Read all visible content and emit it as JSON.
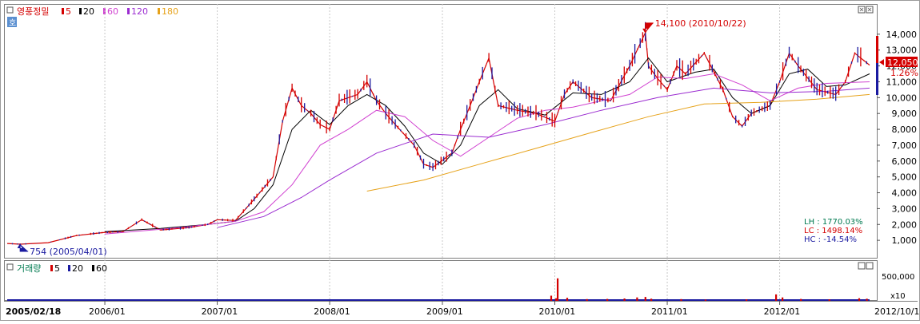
{
  "header": {
    "stock_name": "영풍정밀",
    "toggle_label": "호"
  },
  "price_panel": {
    "ma_legend": [
      {
        "label": "5",
        "color": "#d40000"
      },
      {
        "label": "20",
        "color": "#000000"
      },
      {
        "label": "60",
        "color": "#d040d0"
      },
      {
        "label": "120",
        "color": "#9a2bd0"
      },
      {
        "label": "180",
        "color": "#e6a21a"
      }
    ],
    "high_annotation": "14,100 (2010/10/22)",
    "low_annotation": "754 (2005/04/01)",
    "current_price": "12,050",
    "change_pct": "1.26%",
    "stats": [
      {
        "label": "LH",
        "value": "1770.03%",
        "color": "#007a50"
      },
      {
        "label": "LC",
        "value": "1498.14%",
        "color": "#d40000"
      },
      {
        "label": "HC",
        "value": "-14.54%",
        "color": "#1a1aa0"
      }
    ]
  },
  "volume_panel": {
    "title": "거래량",
    "ma_legend": [
      {
        "label": "5",
        "color": "#d40000"
      },
      {
        "label": "20",
        "color": "#1a1aa0"
      },
      {
        "label": "60",
        "color": "#000000"
      }
    ],
    "y_tick": "500,000",
    "multiplier": "x10"
  },
  "x_axis": {
    "start_label": "2005/02/18",
    "end_label": "2012/10/19",
    "ticks": [
      "2006/01",
      "2007/01",
      "2008/01",
      "2009/01",
      "2010/01",
      "2011/01",
      "2012/01"
    ]
  },
  "chart_data": {
    "type": "line",
    "y_ticks": [
      "1,000",
      "2,000",
      "3,000",
      "4,000",
      "5,000",
      "6,000",
      "7,000",
      "8,000",
      "9,000",
      "10,000",
      "11,000",
      "12,000",
      "13,000",
      "14,000"
    ],
    "ylim": [
      0,
      15000
    ],
    "xlim": [
      "2005-02-18",
      "2012-10-19"
    ],
    "series": [
      {
        "name": "5",
        "color": "#d40000",
        "points": [
          [
            "2005-02-18",
            800
          ],
          [
            "2005-04-01",
            754
          ],
          [
            "2005-07-01",
            850
          ],
          [
            "2005-10-01",
            1300
          ],
          [
            "2006-01-01",
            1500
          ],
          [
            "2006-03-01",
            1550
          ],
          [
            "2006-05-01",
            2300
          ],
          [
            "2006-07-01",
            1650
          ],
          [
            "2006-10-01",
            1800
          ],
          [
            "2006-12-01",
            2000
          ],
          [
            "2007-01-01",
            2300
          ],
          [
            "2007-03-01",
            2250
          ],
          [
            "2007-05-01",
            3600
          ],
          [
            "2007-07-01",
            5000
          ],
          [
            "2007-08-01",
            8500
          ],
          [
            "2007-09-01",
            10600
          ],
          [
            "2007-10-01",
            9500
          ],
          [
            "2007-11-01",
            9000
          ],
          [
            "2007-12-01",
            8300
          ],
          [
            "2008-01-01",
            8000
          ],
          [
            "2008-02-01",
            9800
          ],
          [
            "2008-04-01",
            10200
          ],
          [
            "2008-05-01",
            11000
          ],
          [
            "2008-06-01",
            9800
          ],
          [
            "2008-07-01",
            9000
          ],
          [
            "2008-08-01",
            8300
          ],
          [
            "2008-10-01",
            7000
          ],
          [
            "2008-11-01",
            5800
          ],
          [
            "2008-12-01",
            5600
          ],
          [
            "2009-02-01",
            6500
          ],
          [
            "2009-03-01",
            8000
          ],
          [
            "2009-04-01",
            9500
          ],
          [
            "2009-05-01",
            11000
          ],
          [
            "2009-06-01",
            12500
          ],
          [
            "2009-07-01",
            9500
          ],
          [
            "2009-09-01",
            9200
          ],
          [
            "2009-11-01",
            9000
          ],
          [
            "2010-01-01",
            8500
          ],
          [
            "2010-02-01",
            10200
          ],
          [
            "2010-03-01",
            11000
          ],
          [
            "2010-05-01",
            10000
          ],
          [
            "2010-07-01",
            9800
          ],
          [
            "2010-09-01",
            12000
          ],
          [
            "2010-10-22",
            14100
          ],
          [
            "2010-11-01",
            12000
          ],
          [
            "2010-12-01",
            11200
          ],
          [
            "2011-01-01",
            10500
          ],
          [
            "2011-02-01",
            12000
          ],
          [
            "2011-03-01",
            11500
          ],
          [
            "2011-05-01",
            12800
          ],
          [
            "2011-07-01",
            10500
          ],
          [
            "2011-08-01",
            8800
          ],
          [
            "2011-09-01",
            8200
          ],
          [
            "2011-10-01",
            9000
          ],
          [
            "2011-12-01",
            9500
          ],
          [
            "2012-01-01",
            11000
          ],
          [
            "2012-02-01",
            12800
          ],
          [
            "2012-03-01",
            12000
          ],
          [
            "2012-05-01",
            10500
          ],
          [
            "2012-07-01",
            10200
          ],
          [
            "2012-08-01",
            11000
          ],
          [
            "2012-09-01",
            12800
          ],
          [
            "2012-10-19",
            12050
          ]
        ]
      },
      {
        "name": "20",
        "color": "#000000",
        "points": [
          [
            "2006-01-01",
            1550
          ],
          [
            "2006-07-01",
            1750
          ],
          [
            "2006-12-01",
            2000
          ],
          [
            "2007-03-01",
            2200
          ],
          [
            "2007-05-01",
            3000
          ],
          [
            "2007-07-01",
            4500
          ],
          [
            "2007-09-01",
            8000
          ],
          [
            "2007-11-01",
            9200
          ],
          [
            "2008-01-01",
            8300
          ],
          [
            "2008-03-01",
            9500
          ],
          [
            "2008-05-01",
            10200
          ],
          [
            "2008-07-01",
            9500
          ],
          [
            "2008-09-01",
            8200
          ],
          [
            "2008-11-01",
            6500
          ],
          [
            "2009-01-01",
            5800
          ],
          [
            "2009-03-01",
            7000
          ],
          [
            "2009-05-01",
            9500
          ],
          [
            "2009-07-01",
            10500
          ],
          [
            "2009-09-01",
            9300
          ],
          [
            "2009-12-01",
            8900
          ],
          [
            "2010-03-01",
            10300
          ],
          [
            "2010-06-01",
            10200
          ],
          [
            "2010-09-01",
            11000
          ],
          [
            "2010-11-01",
            12500
          ],
          [
            "2011-01-01",
            11000
          ],
          [
            "2011-04-01",
            11600
          ],
          [
            "2011-06-01",
            11800
          ],
          [
            "2011-08-01",
            10000
          ],
          [
            "2011-10-01",
            9000
          ],
          [
            "2011-12-01",
            9500
          ],
          [
            "2012-02-01",
            11500
          ],
          [
            "2012-04-01",
            11800
          ],
          [
            "2012-06-01",
            10700
          ],
          [
            "2012-08-01",
            10800
          ],
          [
            "2012-10-19",
            11500
          ]
        ]
      },
      {
        "name": "60",
        "color": "#d040d0",
        "points": [
          [
            "2006-01-01",
            1400
          ],
          [
            "2006-09-01",
            1800
          ],
          [
            "2007-03-01",
            2200
          ],
          [
            "2007-06-01",
            2800
          ],
          [
            "2007-09-01",
            4500
          ],
          [
            "2007-12-01",
            7000
          ],
          [
            "2008-03-01",
            8000
          ],
          [
            "2008-06-01",
            9200
          ],
          [
            "2008-09-01",
            8800
          ],
          [
            "2008-12-01",
            7300
          ],
          [
            "2009-03-01",
            6300
          ],
          [
            "2009-06-01",
            7500
          ],
          [
            "2009-09-01",
            8700
          ],
          [
            "2009-12-01",
            9200
          ],
          [
            "2010-03-01",
            9400
          ],
          [
            "2010-06-01",
            9800
          ],
          [
            "2010-09-01",
            10200
          ],
          [
            "2010-12-01",
            11300
          ],
          [
            "2011-03-01",
            11200
          ],
          [
            "2011-06-01",
            11500
          ],
          [
            "2011-09-01",
            10800
          ],
          [
            "2011-12-01",
            9800
          ],
          [
            "2012-03-01",
            10600
          ],
          [
            "2012-06-01",
            10900
          ],
          [
            "2012-10-19",
            11000
          ]
        ]
      },
      {
        "name": "120",
        "color": "#9a2bd0",
        "points": [
          [
            "2007-01-01",
            1800
          ],
          [
            "2007-06-01",
            2500
          ],
          [
            "2007-10-01",
            3700
          ],
          [
            "2008-01-01",
            4800
          ],
          [
            "2008-06-01",
            6500
          ],
          [
            "2008-12-01",
            7700
          ],
          [
            "2009-06-01",
            7500
          ],
          [
            "2009-12-01",
            8300
          ],
          [
            "2010-06-01",
            9200
          ],
          [
            "2010-12-01",
            10000
          ],
          [
            "2011-06-01",
            10600
          ],
          [
            "2011-12-01",
            10300
          ],
          [
            "2012-06-01",
            10400
          ],
          [
            "2012-10-19",
            10600
          ]
        ]
      },
      {
        "name": "180",
        "color": "#e6a21a",
        "points": [
          [
            "2008-05-01",
            4100
          ],
          [
            "2008-11-01",
            4800
          ],
          [
            "2009-05-01",
            5800
          ],
          [
            "2009-11-01",
            6800
          ],
          [
            "2010-05-01",
            7800
          ],
          [
            "2010-11-01",
            8800
          ],
          [
            "2011-05-01",
            9600
          ],
          [
            "2011-11-01",
            9700
          ],
          [
            "2012-05-01",
            9900
          ],
          [
            "2012-10-19",
            10200
          ]
        ]
      }
    ],
    "volume": {
      "ylim": [
        0,
        700000
      ],
      "bars": [
        [
          "2009-12-20",
          120000
        ],
        [
          "2010-01-05",
          60000
        ],
        [
          "2010-01-10",
          520000
        ],
        [
          "2010-02-10",
          70000
        ],
        [
          "2010-04-15",
          40000
        ],
        [
          "2010-06-20",
          45000
        ],
        [
          "2010-08-15",
          55000
        ],
        [
          "2010-09-25",
          80000
        ],
        [
          "2010-10-22",
          90000
        ],
        [
          "2010-11-10",
          50000
        ],
        [
          "2011-02-15",
          40000
        ],
        [
          "2011-05-05",
          30000
        ],
        [
          "2011-09-15",
          35000
        ],
        [
          "2011-12-20",
          150000
        ],
        [
          "2012-01-10",
          80000
        ],
        [
          "2012-03-10",
          45000
        ],
        [
          "2012-06-10",
          35000
        ],
        [
          "2012-09-15",
          60000
        ],
        [
          "2012-10-10",
          50000
        ]
      ]
    }
  }
}
